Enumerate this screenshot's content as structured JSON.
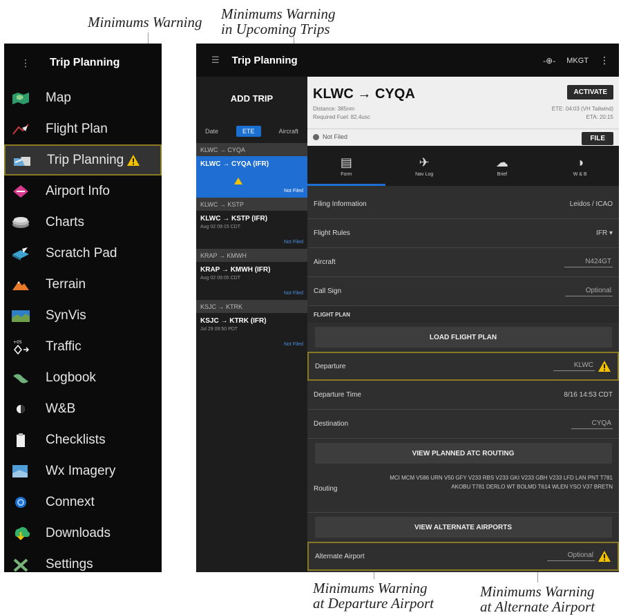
{
  "callouts": {
    "min_warning": "Minimums Warning",
    "upcoming_line1": "Minimums Warning",
    "upcoming_line2": "in Upcoming Trips",
    "departure_line1": "Minimums Warning",
    "departure_line2": "at Departure Airport",
    "alternate_line1": "Minimums Warning",
    "alternate_line2": "at Alternate Airport"
  },
  "menu": {
    "title": "Trip Planning",
    "items": [
      {
        "label": "Map",
        "icon": "map-icon"
      },
      {
        "label": "Flight Plan",
        "icon": "flight-plan-icon"
      },
      {
        "label": "Trip Planning",
        "icon": "trip-planning-icon",
        "selected": true,
        "warning": true
      },
      {
        "label": "Airport Info",
        "icon": "airport-info-icon"
      },
      {
        "label": "Charts",
        "icon": "charts-icon"
      },
      {
        "label": "Scratch Pad",
        "icon": "scratch-pad-icon"
      },
      {
        "label": "Terrain",
        "icon": "terrain-icon"
      },
      {
        "label": "SynVis",
        "icon": "synvis-icon"
      },
      {
        "label": "Traffic",
        "icon": "traffic-icon"
      },
      {
        "label": "Logbook",
        "icon": "logbook-icon"
      },
      {
        "label": "W&B",
        "icon": "weight-balance-icon"
      },
      {
        "label": "Checklists",
        "icon": "checklists-icon"
      },
      {
        "label": "Wx Imagery",
        "icon": "wx-imagery-icon"
      },
      {
        "label": "Connext",
        "icon": "connext-icon"
      },
      {
        "label": "Downloads",
        "icon": "downloads-icon"
      },
      {
        "label": "Settings",
        "icon": "settings-icon"
      }
    ]
  },
  "app": {
    "title": "Trip Planning",
    "topbar_status": "MKGT",
    "add_trip": "ADD TRIP",
    "sort": {
      "date": "Date",
      "ete": "ETE",
      "aircraft": "Aircraft"
    },
    "groups": [
      {
        "header": "KLWC → CYQA",
        "trip": "KLWC → CYQA (IFR)",
        "date": "",
        "time": "",
        "status": "Not Filed",
        "selected": true
      },
      {
        "header": "KLWC → KSTP",
        "trip": "KLWC → KSTP (IFR)",
        "date": "Aug 02 09:15 CDT",
        "time": "",
        "status": "Not Filed",
        "selected": false
      },
      {
        "header": "KRAP → KMWH",
        "trip": "KRAP → KMWH (IFR)",
        "date": "Aug 02 09:05 CDT",
        "time": "",
        "status": "Not Filed",
        "selected": false
      },
      {
        "header": "KSJC → KTRK",
        "trip": "KSJC → KTRK (IFR)",
        "date": "Jul 29 09:50 PDT",
        "time": "",
        "status": "Not Filed",
        "selected": false
      }
    ],
    "card": {
      "route": "KLWC → CYQA",
      "distance": "Distance: 385nm",
      "fuel": "Required Fuel: 82.4usc",
      "ete": "ETE: 04:03 (VH Tailwind)",
      "eta": "ETA: 20:15",
      "activate": "ACTIVATE",
      "filed_status": "Not Filed",
      "file": "FILE"
    },
    "tabs": [
      {
        "label": "Form",
        "icon": "form-icon"
      },
      {
        "label": "Nav Log",
        "icon": "nav-log-icon"
      },
      {
        "label": "Brief",
        "icon": "brief-icon"
      },
      {
        "label": "W & B",
        "icon": "weight-balance-icon"
      }
    ],
    "rows": {
      "filing_info": {
        "label": "Filing Information",
        "value": "Leidos / ICAO"
      },
      "flight_rules": {
        "label": "Flight Rules",
        "value": "IFR ▾"
      },
      "aircraft": {
        "label": "Aircraft",
        "value": "N424GT"
      },
      "call_sign": {
        "label": "Call Sign",
        "value": "Optional"
      },
      "flight_plan_section": "FLIGHT PLAN",
      "load_flight_plan": "LOAD FLIGHT PLAN",
      "departure": {
        "label": "Departure",
        "value": "KLWC"
      },
      "departure_time": {
        "label": "Departure Time",
        "value": "8/16 14:53 CDT"
      },
      "destination": {
        "label": "Destination",
        "value": "CYQA"
      },
      "view_atc_routing": "VIEW PLANNED ATC ROUTING",
      "routing": {
        "label": "Routing",
        "value": "MCI MCM V586 URN V50 GFY V233 RBS V233 GKI V233 GBH V233 LFD LAN PNT T781 AKOBU T781 DERLO WT BOLMD T614 WLEN YSO V37 BRETN"
      },
      "view_alternates": "VIEW ALTERNATE AIRPORTS",
      "alternate": {
        "label": "Alternate Airport",
        "value": "Optional"
      }
    }
  },
  "colors": {
    "selected_blue": "#1f6ed4",
    "warning_yellow": "#f2c200",
    "highlight_border": "#8a7a23"
  }
}
